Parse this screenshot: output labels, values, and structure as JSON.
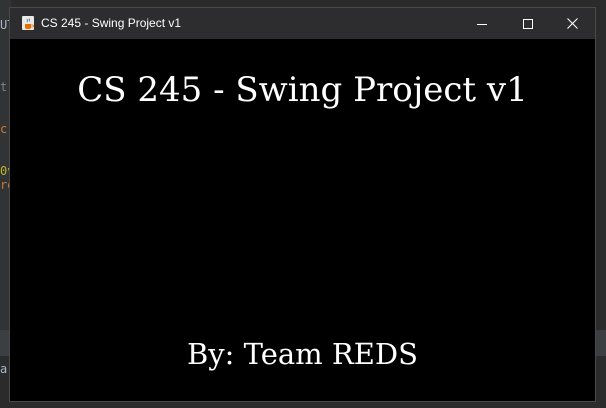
{
  "window": {
    "title": "CS 245 - Swing Project v1",
    "icon": "java-cup-icon",
    "controls": {
      "minimize_icon": "minimize-icon",
      "maximize_icon": "maximize-icon",
      "close_icon": "close-icon"
    }
  },
  "content": {
    "heading": "CS 245 - Swing Project v1",
    "byline": "By: Team REDS"
  },
  "background_ide": {
    "fragments": [
      "UT",
      "t",
      "c",
      "0v",
      "re",
      "a"
    ]
  },
  "colors": {
    "titlebar": "#2d2d30",
    "content_background": "#000000",
    "text": "#ffffff",
    "ide_background": "#2b2b2b"
  }
}
